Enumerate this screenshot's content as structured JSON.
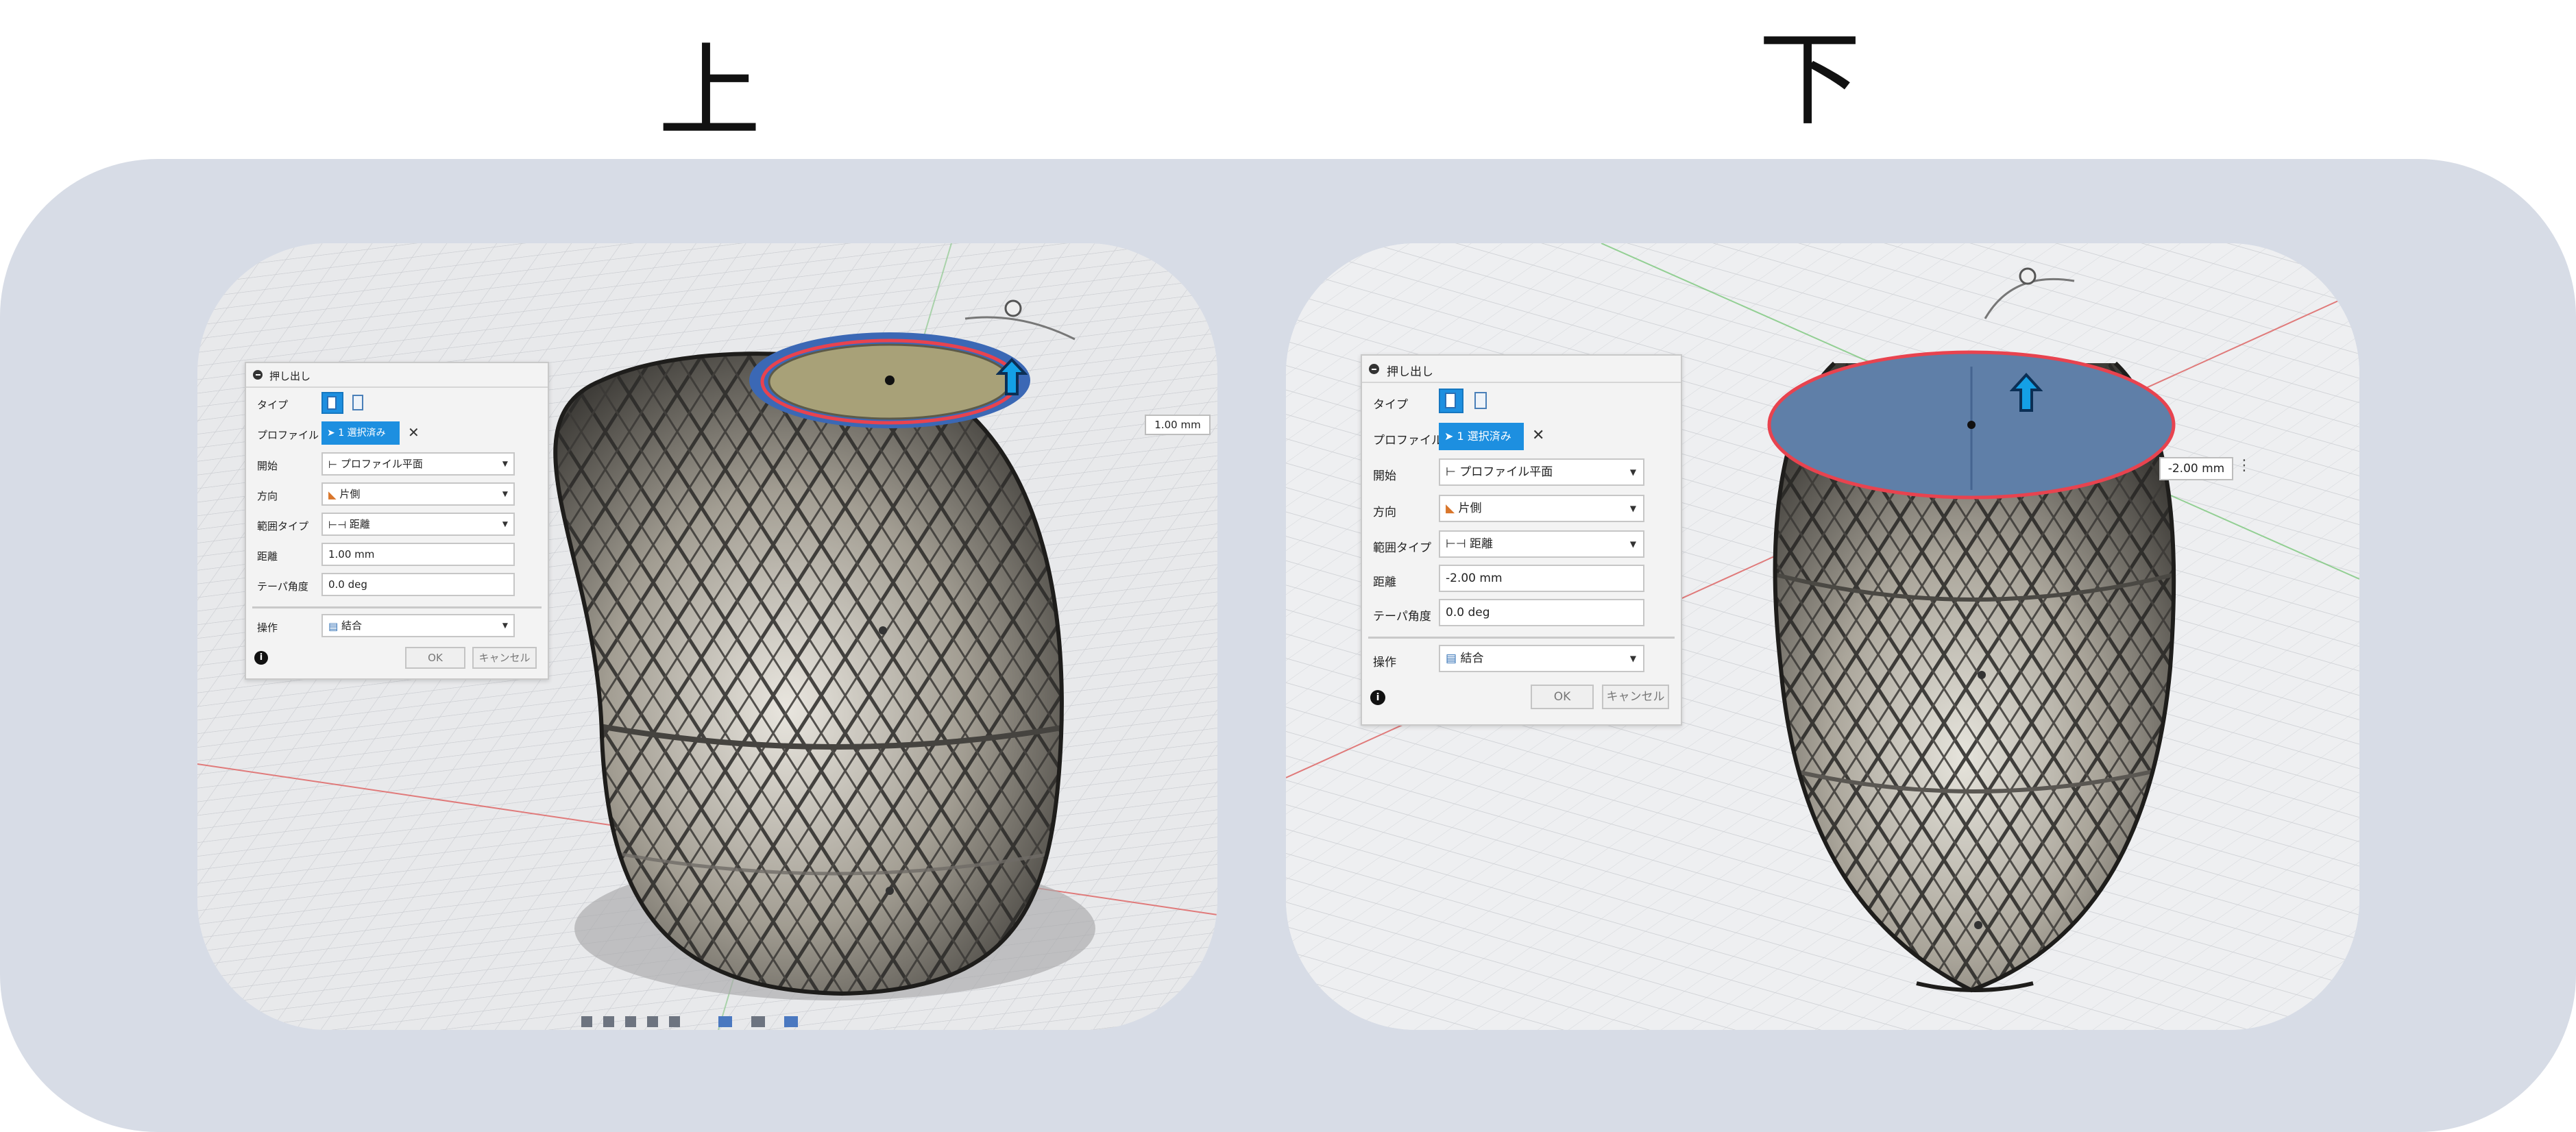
{
  "headings": {
    "left": "上",
    "right": "下"
  },
  "dialog_left": {
    "title": "押し出し",
    "type_label": "タイプ",
    "profile_label": "プロファイル",
    "profile_value": "1 選択済み",
    "start_label": "開始",
    "start_value": "プロファイル平面",
    "direction_label": "方向",
    "direction_value": "片側",
    "extent_label": "範囲タイプ",
    "extent_value": "距離",
    "distance_label": "距離",
    "distance_value": "1.00 mm",
    "taper_label": "テーパ角度",
    "taper_value": "0.0 deg",
    "operation_label": "操作",
    "operation_value": "結合",
    "ok": "OK",
    "cancel": "キャンセル"
  },
  "dialog_right": {
    "title": "押し出し",
    "type_label": "タイプ",
    "profile_label": "プロファイル",
    "profile_value": "1 選択済み",
    "start_label": "開始",
    "start_value": "プロファイル平面",
    "direction_label": "方向",
    "direction_value": "片側",
    "extent_label": "範囲タイプ",
    "extent_value": "距離",
    "distance_label": "距離",
    "distance_value": "-2.00 mm",
    "taper_label": "テーパ角度",
    "taper_value": "0.0 deg",
    "operation_label": "操作",
    "operation_value": "結合",
    "ok": "OK",
    "cancel": "キャンセル"
  },
  "viewport_left": {
    "dimension": "1.00 mm"
  },
  "viewport_right": {
    "dimension": "-2.00 mm"
  },
  "colors": {
    "backdrop": "#d7dce6",
    "accent": "#1d8fe0",
    "selection_edge": "#e8434f",
    "selected_face_blue": "#5f7fa8"
  }
}
